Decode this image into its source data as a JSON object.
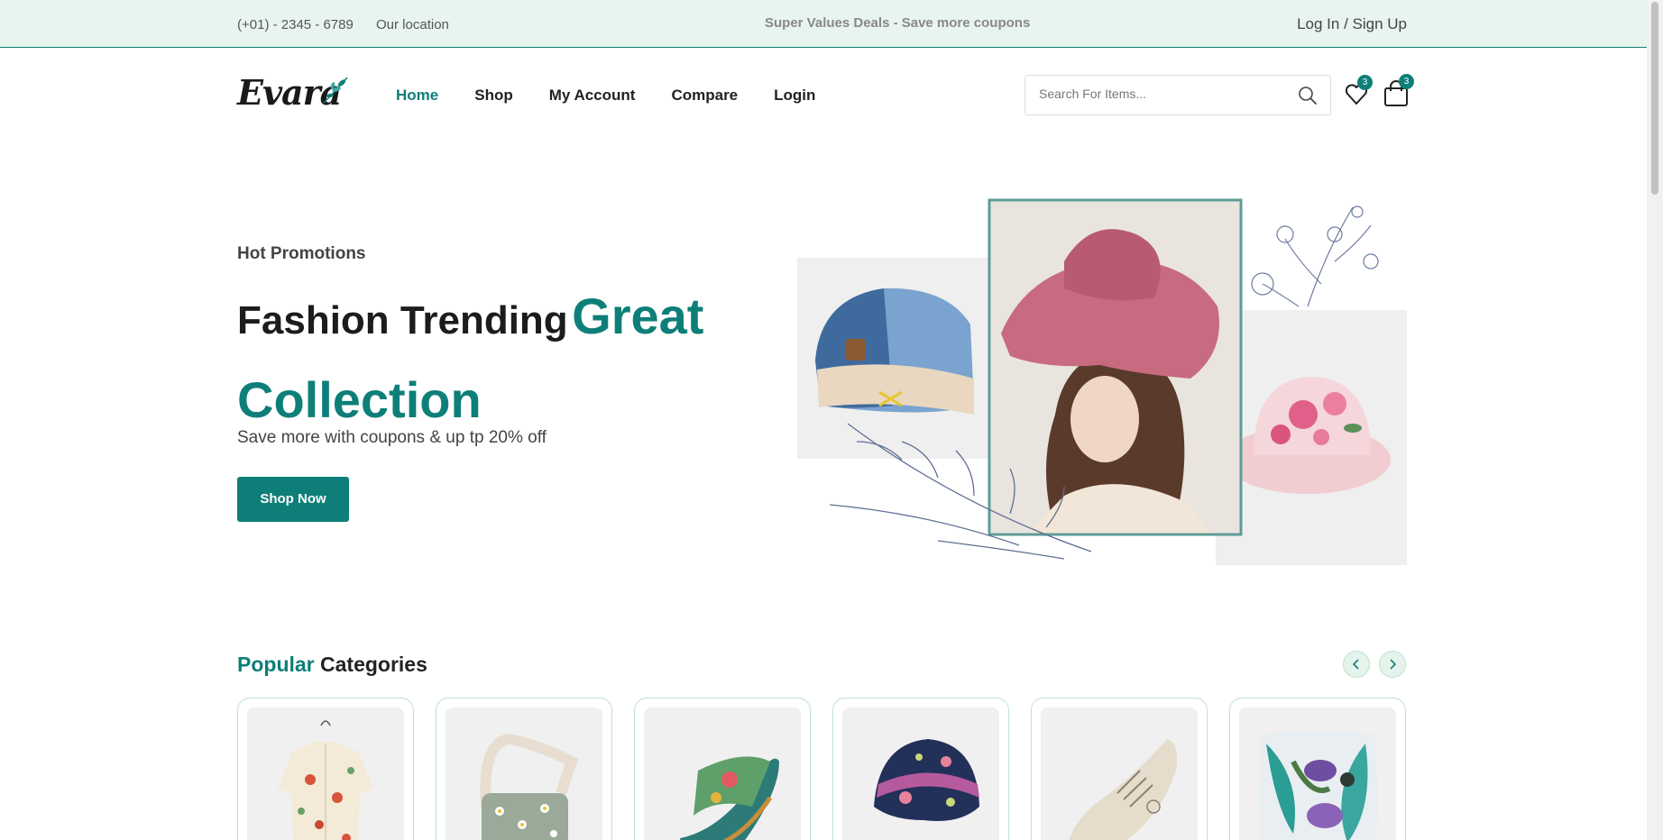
{
  "topbar": {
    "phone": "(+01) - 2345 - 6789",
    "location": "Our location",
    "deals": "Super Values Deals - Save more coupons",
    "auth": "Log In / Sign Up"
  },
  "header": {
    "logo_text": "Evara",
    "nav": [
      "Home",
      "Shop",
      "My Account",
      "Compare",
      "Login"
    ],
    "active_nav": "Home",
    "search_placeholder": "Search For Items...",
    "wishlist_count": "3",
    "cart_count": "3"
  },
  "hero": {
    "subtitle": "Hot Promotions",
    "title_dark": "Fashion Trending",
    "title_accent_1": "Great",
    "title_accent_2": "Collection",
    "description": "Save more with coupons & up tp 20% off",
    "button": "Shop Now"
  },
  "categories": {
    "title_accent": "Popular",
    "title_rest": "Categories",
    "items": [
      "shirt",
      "bag",
      "sandal",
      "beanie",
      "sneaker",
      "pillow"
    ]
  },
  "colors": {
    "accent": "#0e7f78",
    "topbar_bg": "#e8f5ee"
  }
}
